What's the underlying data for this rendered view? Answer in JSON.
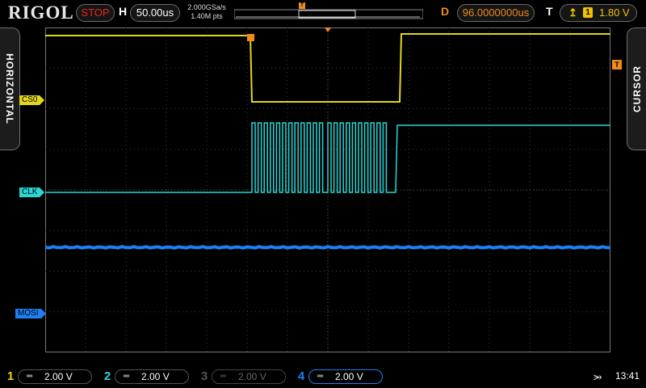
{
  "brand": "RIGOL",
  "header": {
    "run_state": "STOP",
    "h_letter": "H",
    "timebase": "50.00us",
    "sample_rate": "2.000GSa/s",
    "memory_depth": "1.40M pts",
    "d_letter": "D",
    "delay": "96.0000000us",
    "t_letter": "T",
    "trigger_source": "1",
    "trigger_level": "1.80 V",
    "trigger_edge_glyph": "↥",
    "trigger_marker": "T"
  },
  "side_tabs": {
    "left": "HORIZONTAL",
    "right": "CURSOR"
  },
  "channel_tags": {
    "ch1": "CS0",
    "ch2": "CLK",
    "ch4": "MOSI"
  },
  "channels": [
    {
      "num": "1",
      "coupling": "═",
      "scale": "2.00 V",
      "color": "#e1d61d",
      "state": "on"
    },
    {
      "num": "2",
      "coupling": "═",
      "scale": "2.00 V",
      "color": "#2ad6d6",
      "state": "on"
    },
    {
      "num": "3",
      "coupling": "═",
      "scale": "2.00 V",
      "color": "#555555",
      "state": "off"
    },
    {
      "num": "4",
      "coupling": "═",
      "scale": "2.00 V",
      "color": "#1f7ff2",
      "state": "active"
    }
  ],
  "status": {
    "usb_icon": "usb-icon",
    "time": "13:41"
  },
  "colors": {
    "ch1": "#e1d61d",
    "ch2": "#2ad6d6",
    "ch4": "#1f7ff2",
    "run_stop": "#e8271d",
    "delay": "#f28a1c",
    "trigger": "#f2c200"
  },
  "trigger_position_fraction": 0.5
}
